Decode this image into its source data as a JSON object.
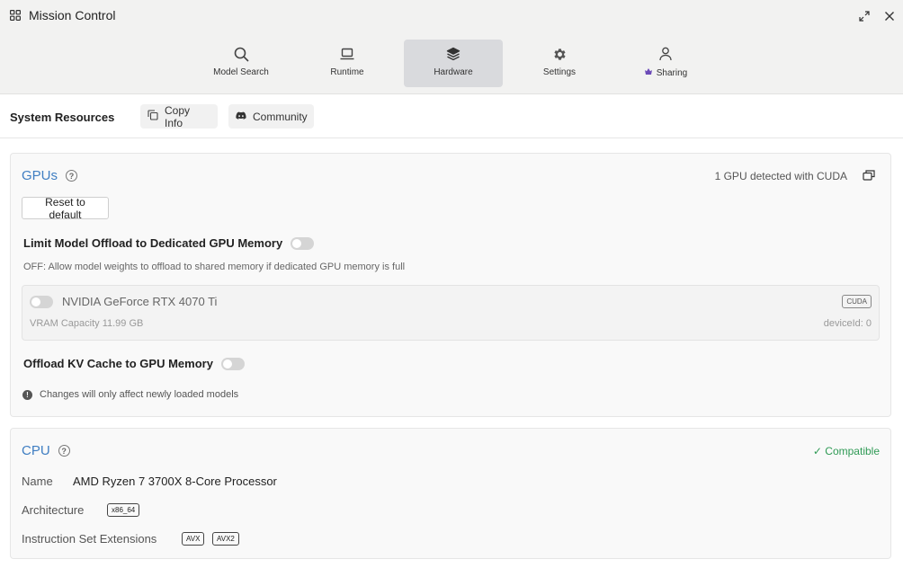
{
  "window": {
    "title": "Mission Control"
  },
  "nav": {
    "tabs": [
      {
        "label": "Model Search",
        "icon": "search-icon"
      },
      {
        "label": "Runtime",
        "icon": "laptop-icon"
      },
      {
        "label": "Hardware",
        "icon": "layers-icon",
        "active": true
      },
      {
        "label": "Settings",
        "icon": "gear-icon"
      },
      {
        "label": "Sharing",
        "icon": "user-icon"
      }
    ]
  },
  "resources": {
    "title": "System Resources",
    "copy_label": "Copy Info",
    "community_label": "Community"
  },
  "gpu": {
    "title": "GPUs",
    "detected": "1 GPU detected with CUDA",
    "reset_label": "Reset to default",
    "limit_offload_label": "Limit Model Offload to Dedicated GPU Memory",
    "limit_offload_desc": "OFF: Allow model weights to offload to shared memory if dedicated GPU memory is full",
    "device": {
      "name": "NVIDIA GeForce RTX 4070 Ti",
      "badge": "CUDA",
      "vram": "VRAM Capacity 11.99 GB",
      "device_id": "deviceId: 0"
    },
    "kv_cache_label": "Offload KV Cache to GPU Memory",
    "note": "Changes will only affect newly loaded models"
  },
  "cpu": {
    "title": "CPU",
    "status": "✓ Compatible",
    "name_label": "Name",
    "name_value": "AMD Ryzen 7 3700X 8-Core Processor",
    "arch_label": "Architecture",
    "arch_value": "x86_64",
    "ext_label": "Instruction Set Extensions",
    "extensions": [
      "AVX",
      "AVX2"
    ]
  },
  "colors": {
    "accent": "#3f7ec2",
    "compatible": "#2f9a55",
    "topbar_bg": "#f2f2f1",
    "active_tab_bg": "#d9dadd"
  }
}
